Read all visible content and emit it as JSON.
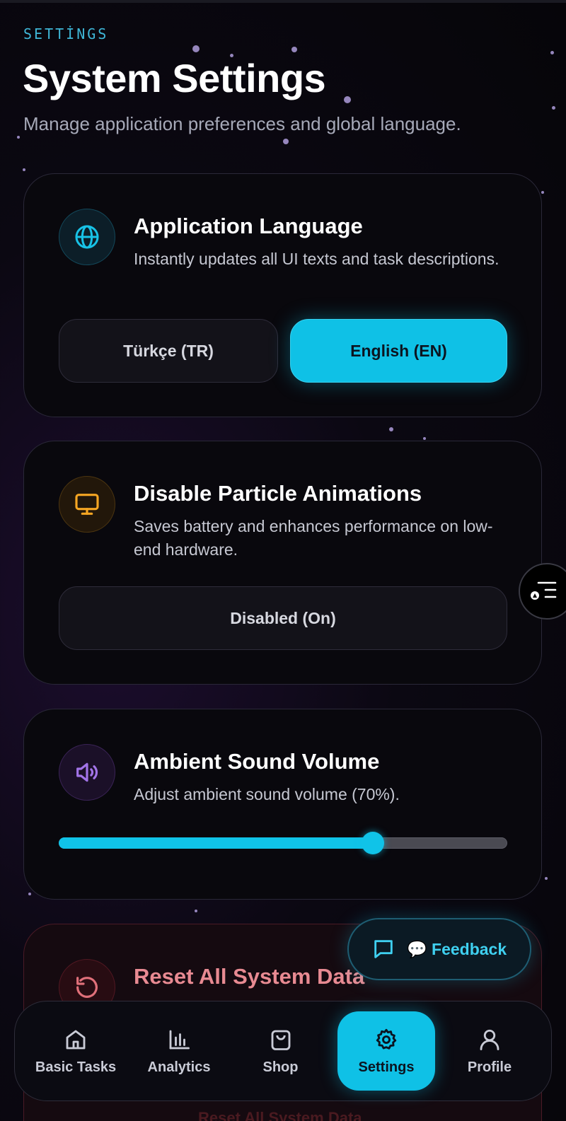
{
  "header": {
    "eyebrow": "SETTİNGS",
    "title": "System Settings",
    "subtitle": "Manage application preferences and global language."
  },
  "language_card": {
    "title": "Application Language",
    "description": "Instantly updates all UI texts and task descriptions.",
    "icon": "globe-icon",
    "options": [
      {
        "label": "Türkçe (TR)",
        "selected": false
      },
      {
        "label": "English (EN)",
        "selected": true
      }
    ]
  },
  "particles_card": {
    "title": "Disable Particle Animations",
    "description": "Saves battery and enhances performance on low-end hardware.",
    "icon": "monitor-icon",
    "toggle_label": "Disabled (On)"
  },
  "sound_card": {
    "title": "Ambient Sound Volume",
    "description": "Adjust ambient sound volume (70%).",
    "icon": "speaker-icon",
    "volume_percent": 70
  },
  "reset_card": {
    "title": "Reset All System Data",
    "icon": "reset-icon",
    "button_label": "Reset All System Data"
  },
  "feedback": {
    "label": "💬 Feedback",
    "icon": "chat-bubble-icon"
  },
  "side_fab": {
    "icon": "filter-list-icon"
  },
  "nav": {
    "items": [
      {
        "label": "Basic Tasks",
        "icon": "home-icon",
        "selected": false
      },
      {
        "label": "Analytics",
        "icon": "bar-chart-icon",
        "selected": false
      },
      {
        "label": "Shop",
        "icon": "shopping-bag-icon",
        "selected": false
      },
      {
        "label": "Settings",
        "icon": "gear-icon",
        "selected": true
      },
      {
        "label": "Profile",
        "icon": "user-icon",
        "selected": false
      }
    ]
  },
  "colors": {
    "accent": "#0fc1e6",
    "amber": "#f5a623",
    "violet": "#a274e8",
    "danger": "#e0707a"
  }
}
